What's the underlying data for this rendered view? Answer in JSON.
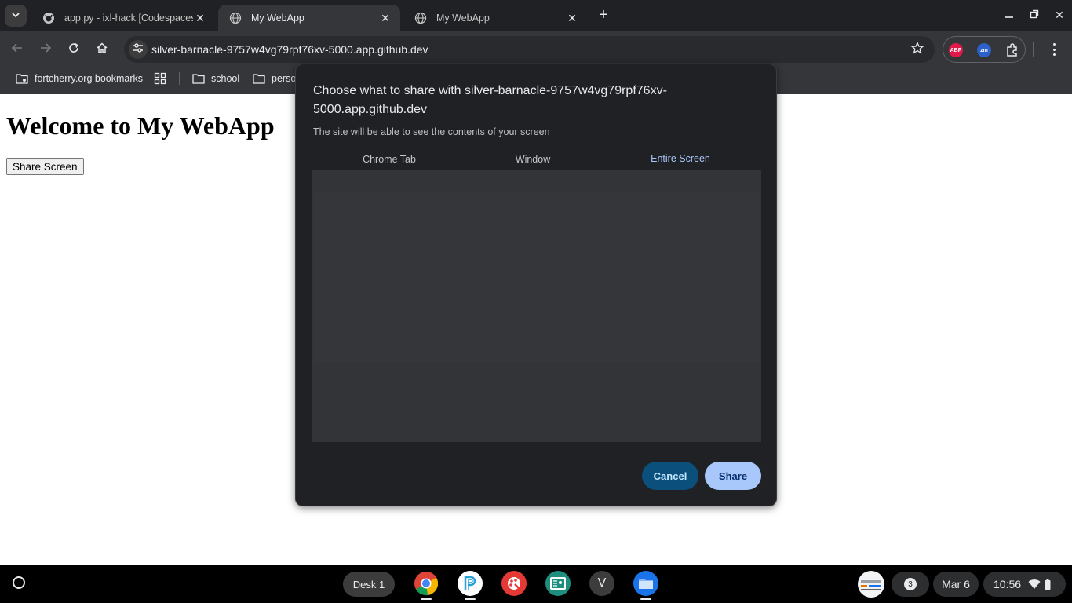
{
  "browser": {
    "tabs": [
      {
        "title": "app.py - ixl-hack [Codespaces:",
        "favicon": "github-icon",
        "active": false
      },
      {
        "title": "My WebApp",
        "favicon": "globe-icon",
        "active": true
      },
      {
        "title": "My WebApp",
        "favicon": "globe-icon",
        "active": false
      }
    ],
    "url": "silver-barnacle-9757w4vg79rpf76xv-5000.app.github.dev",
    "extensions": [
      {
        "label": "ABP",
        "color": "#e0194a"
      },
      {
        "label": "zm",
        "color": "#2d60c9"
      }
    ],
    "bookmarks": [
      {
        "label": "fortcherry.org bookmarks",
        "icon": "managed-folder-icon"
      },
      {
        "label": "school",
        "icon": "folder-icon"
      },
      {
        "label": "perso",
        "icon": "folder-icon"
      }
    ]
  },
  "page": {
    "heading": "Welcome to My WebApp",
    "share_button": "Share Screen"
  },
  "dialog": {
    "title": "Choose what to share with silver-barnacle-9757w4vg79rpf76xv-5000.app.github.dev",
    "subtitle": "The site will be able to see the contents of your screen",
    "tabs": [
      {
        "label": "Chrome Tab",
        "selected": false
      },
      {
        "label": "Window",
        "selected": false
      },
      {
        "label": "Entire Screen",
        "selected": true
      }
    ],
    "cancel_label": "Cancel",
    "share_label": "Share",
    "accent": "#a8c7fa"
  },
  "shelf": {
    "desk_label": "Desk 1",
    "apps": [
      "chrome-icon",
      "pearson-icon",
      "paint-icon",
      "classroom-icon",
      "v-app-icon",
      "files-icon"
    ],
    "v_app_letter": "V",
    "notification_count": "3",
    "date": "Mar 6",
    "time": "10:56"
  }
}
